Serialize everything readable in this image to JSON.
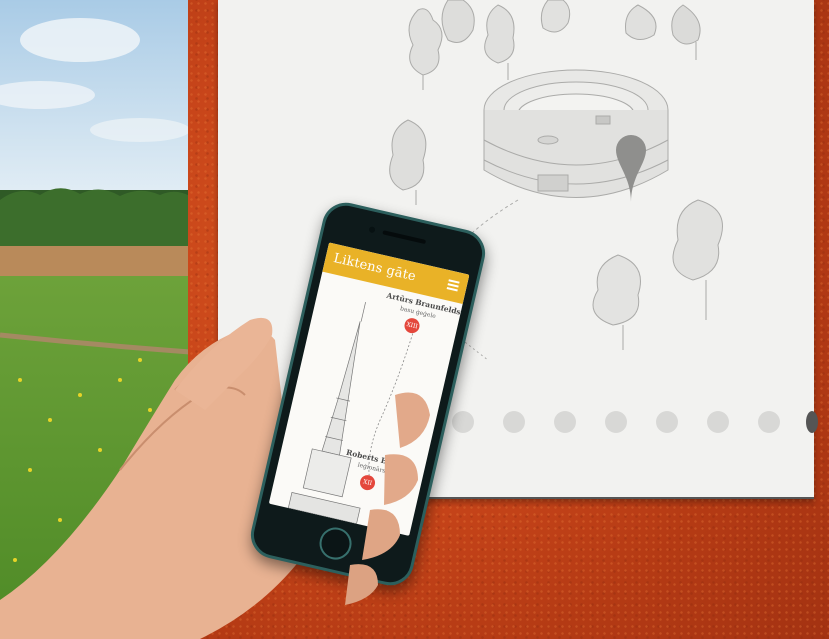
{
  "app": {
    "title": "Liktens gāte",
    "accent_color": "#e9b227",
    "badge_color": "#e4473c",
    "menu_icon": "hamburger-menu-icon"
  },
  "entries": [
    {
      "name": "Artūrs Braunfelds",
      "subtitle": "basu ģeģele",
      "badge": "XIII"
    },
    {
      "name": "Roberts Bergs",
      "subtitle": "leģionārs",
      "badge": "XII"
    }
  ],
  "pagination": {
    "visible_dots": 8,
    "dot_color": "#d8d8d6"
  },
  "scene": {
    "wall_color": "#c8451a",
    "map_pin_icon": "map-pin-icon",
    "phone_frame_color": "#2c5f5d"
  }
}
